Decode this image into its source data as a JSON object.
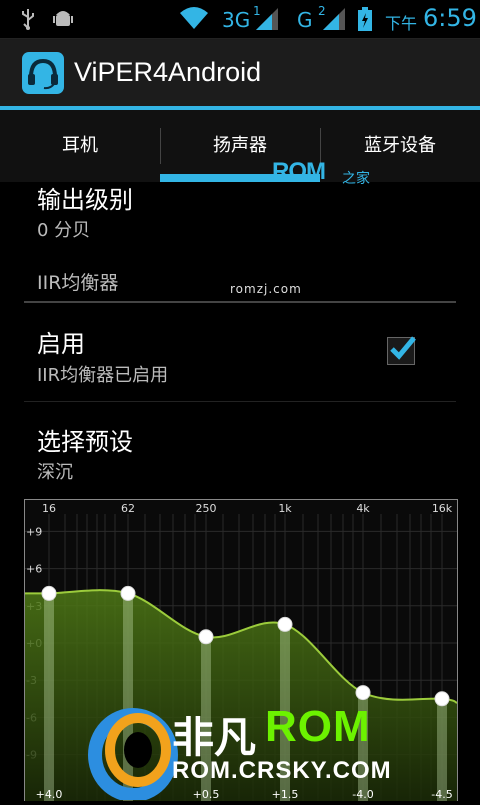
{
  "status_bar": {
    "icons": [
      "usb-icon",
      "android-debug-icon",
      "wifi-icon",
      "signal-icon",
      "battery-charging-icon"
    ],
    "network_1": "3G",
    "network_1_sup": "1",
    "network_2": "G",
    "network_2_sup": "2",
    "time_prefix": "下午",
    "time": "6:59"
  },
  "action_bar": {
    "title": "ViPER4Android",
    "icon": "headset-icon"
  },
  "tabs": [
    {
      "label": "耳机",
      "selected": false
    },
    {
      "label": "扬声器",
      "selected": true
    },
    {
      "label": "蓝牙设备",
      "selected": false
    }
  ],
  "watermark": {
    "rom": "ROM",
    "rom_suffix": "之家",
    "url": "romzj.com"
  },
  "prefs": {
    "output_level": {
      "title": "输出级别",
      "summary": "0 分贝"
    },
    "section_header": "IIR均衡器",
    "enable": {
      "title": "启用",
      "summary": "IIR均衡器已启用",
      "checked": true
    },
    "preset": {
      "title": "选择预设",
      "summary": "深沉"
    }
  },
  "equalizer": {
    "freq_labels": [
      "16",
      "62",
      "250",
      "1k",
      "4k",
      "16k"
    ],
    "db_labels": [
      "+9",
      "+6",
      "+3",
      "+0",
      "-3",
      "-6",
      "-9"
    ],
    "bands": [
      {
        "gain_label": "+4.0",
        "gain": 4.0
      },
      {
        "gain_label": "",
        "gain": 4.0
      },
      {
        "gain_label": "+0.5",
        "gain": 0.5
      },
      {
        "gain_label": "+1.5",
        "gain": 1.5
      },
      {
        "gain_label": "-4.0",
        "gain": -4.0
      },
      {
        "gain_label": "-4.5",
        "gain": -4.5
      }
    ],
    "curve_color": "#9ccc3c",
    "fill_color": "#3d5a12"
  },
  "logo": {
    "cn": "非凡",
    "rom": "ROM",
    "url": "ROM.CRSKY.COM"
  },
  "colors": {
    "accent": "#33b5e5"
  }
}
